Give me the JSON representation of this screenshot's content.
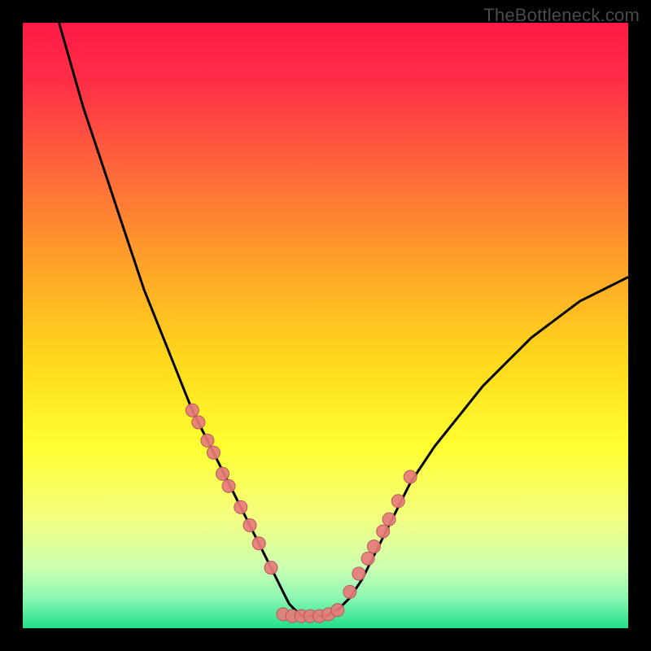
{
  "watermark": "TheBottleneck.com",
  "colors": {
    "frame": "#000000",
    "curve": "#000000",
    "marker_fill": "#e77b7b",
    "marker_stroke": "#b55a5a",
    "gradient_stops": [
      {
        "offset": 0.0,
        "color": "#ff1a47"
      },
      {
        "offset": 0.1,
        "color": "#ff2f46"
      },
      {
        "offset": 0.25,
        "color": "#ff6a3a"
      },
      {
        "offset": 0.4,
        "color": "#ffa328"
      },
      {
        "offset": 0.55,
        "color": "#ffd61c"
      },
      {
        "offset": 0.7,
        "color": "#ffff30"
      },
      {
        "offset": 0.82,
        "color": "#f2ff82"
      },
      {
        "offset": 0.9,
        "color": "#ccffb0"
      },
      {
        "offset": 0.95,
        "color": "#8cf7b4"
      },
      {
        "offset": 1.0,
        "color": "#1fe08a"
      }
    ]
  },
  "chart_data": {
    "type": "line",
    "title": "",
    "xlabel": "",
    "ylabel": "",
    "xlim": [
      0,
      100
    ],
    "ylim": [
      0,
      100
    ],
    "curve": {
      "name": "bottleneck-curve",
      "x": [
        6,
        8,
        10,
        12,
        14,
        16,
        18,
        20,
        22,
        24,
        26,
        28,
        30,
        32,
        34,
        36,
        38,
        40,
        42,
        43,
        44,
        45,
        46,
        47,
        48,
        50,
        52,
        54,
        56,
        58,
        60,
        62,
        64,
        68,
        72,
        76,
        80,
        84,
        88,
        92,
        96,
        100
      ],
      "y": [
        100,
        93,
        86,
        80,
        74,
        68,
        62,
        56,
        51,
        46,
        41,
        36,
        32,
        28,
        24,
        20,
        16,
        12,
        8,
        6,
        4,
        3,
        2,
        2,
        2,
        2,
        3,
        5,
        8,
        12,
        16,
        20,
        24,
        30,
        35,
        40,
        44,
        48,
        51,
        54,
        56,
        58
      ]
    },
    "series": [
      {
        "name": "left-cluster",
        "x": [
          28.0,
          29.0,
          30.5,
          31.5,
          33.0,
          34.0,
          36.0,
          37.5,
          39.0,
          41.0
        ],
        "y": [
          36.0,
          34.0,
          31.0,
          29.0,
          25.5,
          23.5,
          20.0,
          17.0,
          14.0,
          10.0
        ]
      },
      {
        "name": "bottom-cluster",
        "x": [
          43.0,
          44.5,
          46.0,
          47.5,
          49.0,
          50.5,
          52.0
        ],
        "y": [
          2.3,
          2.0,
          2.0,
          2.0,
          2.0,
          2.3,
          3.0
        ]
      },
      {
        "name": "right-cluster",
        "x": [
          54.0,
          55.5,
          57.0,
          58.0,
          59.5,
          60.5,
          62.0,
          64.0
        ],
        "y": [
          6.0,
          9.0,
          11.5,
          13.5,
          16.0,
          18.0,
          21.0,
          25.0
        ]
      }
    ],
    "marker_radius_px": 8
  }
}
